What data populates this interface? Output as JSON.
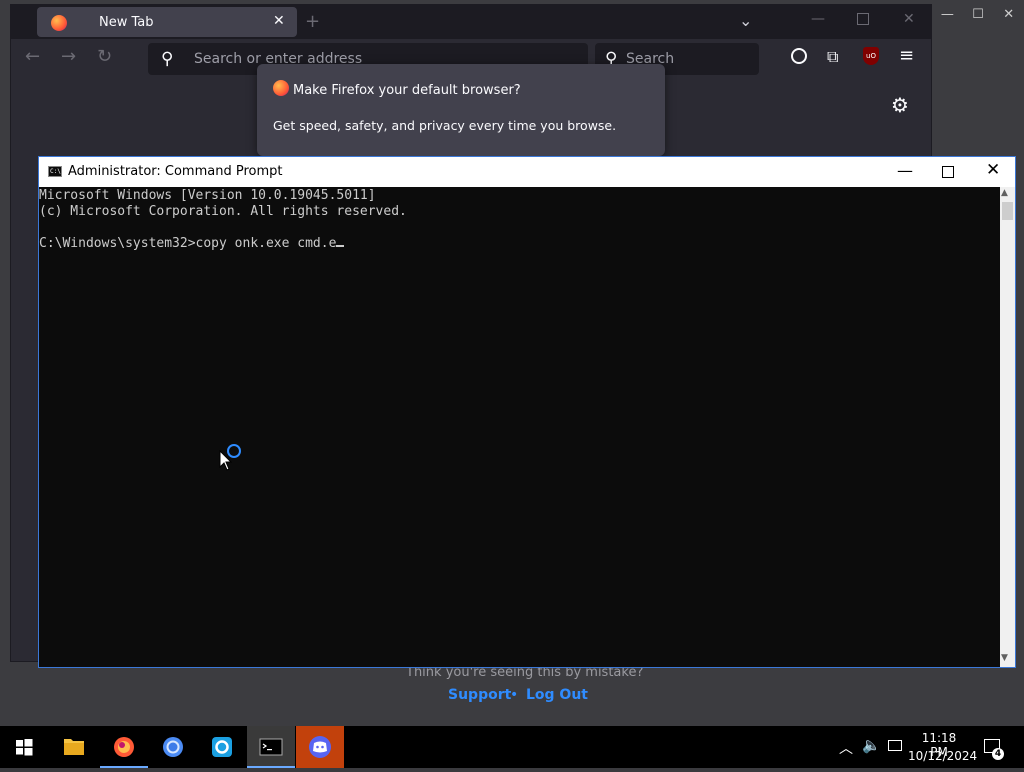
{
  "firefox": {
    "tab_title": "New Tab",
    "address_placeholder": "Search or enter address",
    "search_placeholder": "Search",
    "popup": {
      "title": "Make Firefox your default browser?",
      "text": "Get speed, safety, and privacy every time you browse."
    }
  },
  "background_page": {
    "prompt": "Think you're seeing this by mistake?",
    "support_link": "Support",
    "separator": "•",
    "logout_link": "Log Out"
  },
  "cmd": {
    "title": "Administrator: Command Prompt",
    "lines": [
      "Microsoft Windows [Version 10.0.19045.5011]",
      "(c) Microsoft Corporation. All rights reserved.",
      "",
      "C:\\Windows\\system32>copy onk.exe cmd.e"
    ]
  },
  "taskbar": {
    "apps": [
      "file-explorer",
      "firefox",
      "chrome",
      "cloud-app",
      "command-prompt",
      "discord"
    ],
    "time": "11:18 PM",
    "date": "10/12/2024",
    "notification_count": "4"
  },
  "colors": {
    "accent": "#3b78d8",
    "link": "#2f8cff",
    "discord_taskbar": "#c2410c"
  }
}
